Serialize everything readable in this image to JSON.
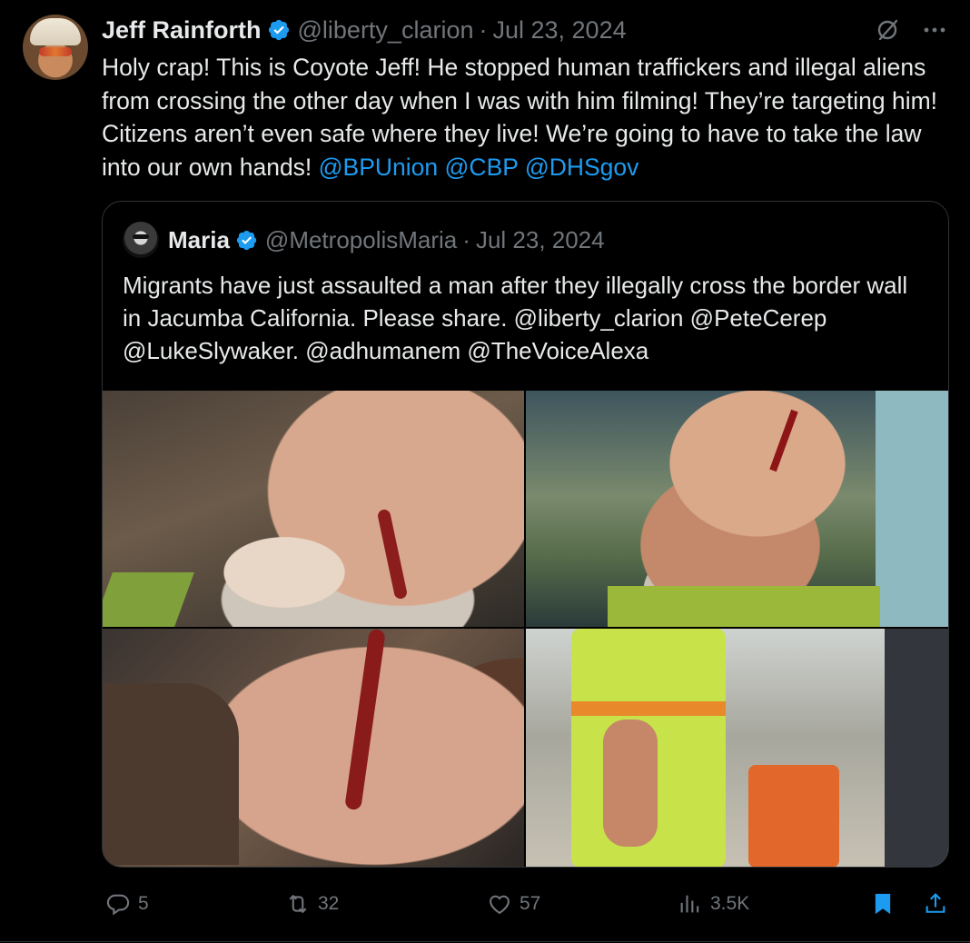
{
  "tweet": {
    "author_name": "Jeff Rainforth",
    "handle": "@liberty_clarion",
    "separator": "·",
    "date": "Jul 23, 2024",
    "text_plain": "Holy crap! This is Coyote Jeff! He stopped human traffickers and illegal aliens from crossing the other day when I was with him filming! They’re targeting him! Citizens aren’t even safe where they live! We’re going to have to take the law into our own hands! ",
    "mentions": [
      "@BPUnion",
      "@CBP",
      "@DHSgov"
    ]
  },
  "quote": {
    "author_name": "Maria",
    "handle": "@MetropolisMaria",
    "separator": "·",
    "date": "Jul 23, 2024",
    "text": "Migrants have just assaulted a man after they illegally cross the border wall in Jacumba California. Please share. @liberty_clarion @PeteCerep @LukeSlywaker. @adhumanem @TheVoiceAlexa"
  },
  "actions": {
    "reply_count": "5",
    "retweet_count": "32",
    "like_count": "57",
    "view_count": "3.5K"
  },
  "colors": {
    "accent": "#1d9bf0",
    "muted": "#71767b",
    "background": "#000000"
  },
  "icons": [
    "verified-badge-icon",
    "grok-icon",
    "more-icon",
    "reply-icon",
    "retweet-icon",
    "like-icon",
    "views-icon",
    "bookmark-icon",
    "share-icon"
  ]
}
